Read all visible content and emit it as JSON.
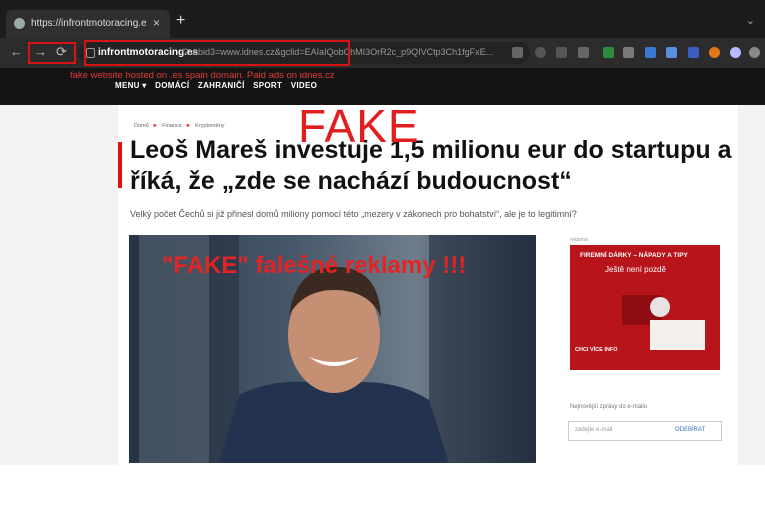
{
  "browser": {
    "tab_title": "https://infrontmotoracing.es/?s...",
    "tab_close": "×",
    "new_tab": "+",
    "window_control": "⌄",
    "url_host": "infrontmotoracing.es",
    "url_rest": "/?subid3=www.idnes.cz&gclid=EAIaIQobChMI3OrR2c_p9QIVCtp3Ch1fgFxE...",
    "nav": {
      "back": "←",
      "forward": "→",
      "reload": "⟳"
    }
  },
  "annotation": "fake website hosted on .es spain domain. Paid ads on idnes.cz",
  "site_menu": [
    "MENU ▾",
    "DOMÁCÍ",
    "ZAHRANIČÍ",
    "SPORT",
    "VIDEO"
  ],
  "breadcrumbs": [
    "Domů",
    "Finance",
    "Kryptoměny"
  ],
  "overlay_fake_big": "FAKE",
  "headline": "Leoš Mareš investuje 1,5 milionu eur do startupu a říká, že „zde se nachází budoucnost“",
  "perex": "Velký počet Čechů si již přinesl domů miliony pomocí této „mezery v zákonech pro bohatství“, ale je to legitimní?",
  "overlay_fake_photo": "\"FAKE\" falešné reklamy !!!",
  "sidebar": {
    "ad_label": "reklama",
    "ad_title": "FIREMNÍ DÁRKY – NÁPADY A TIPY",
    "ad_subtitle": "Ještě není pozdě",
    "ad_cta": "CHCI VÍCE INFO",
    "newsletter_label": "Nejnovější zprávy do e-mailu",
    "email_placeholder": "zadejte e-mail",
    "subscribe_label": "ODEBÍRAT"
  },
  "colors": {
    "annotation_red": "#d61414",
    "ad_red": "#b8141b"
  }
}
